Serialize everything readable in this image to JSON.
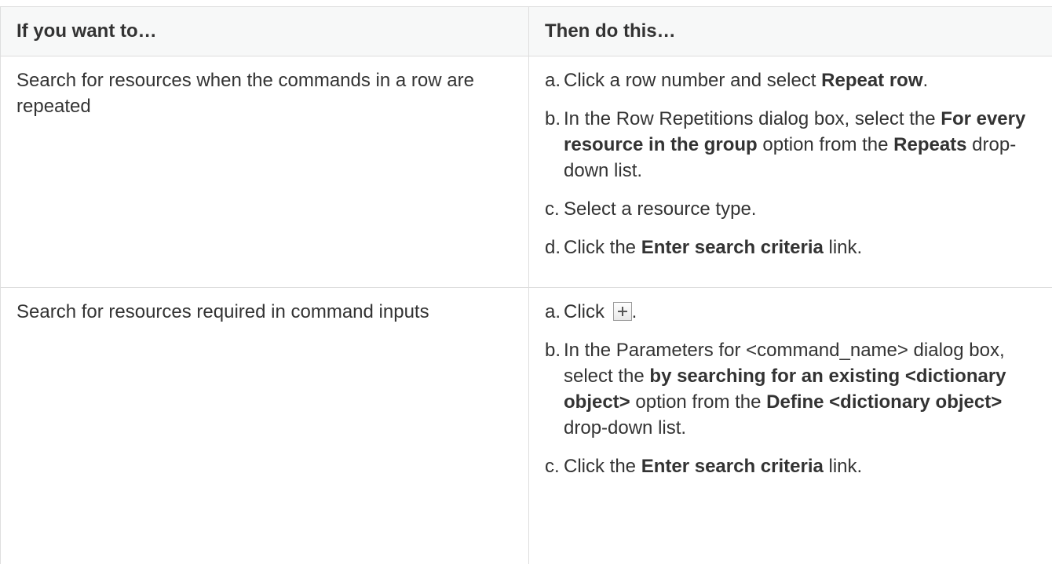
{
  "table": {
    "headers": [
      "If you want to…",
      "Then do this…"
    ],
    "rows": [
      {
        "condition": "Search for resources when the commands in a row are repeated",
        "steps": [
          {
            "mark": "a.",
            "parts": [
              {
                "t": "Click a row number and select "
              },
              {
                "t": "Repeat row",
                "b": true
              },
              {
                "t": "."
              }
            ]
          },
          {
            "mark": "b.",
            "parts": [
              {
                "t": "In the Row Repetitions dialog box, select the "
              },
              {
                "t": "For every resource in the group",
                "b": true
              },
              {
                "t": " option from the "
              },
              {
                "t": "Repeats",
                "b": true
              },
              {
                "t": " drop-down list."
              }
            ]
          },
          {
            "mark": "c.",
            "parts": [
              {
                "t": "Select a resource type."
              }
            ]
          },
          {
            "mark": "d.",
            "parts": [
              {
                "t": "Click the "
              },
              {
                "t": "Enter search criteria",
                "b": true
              },
              {
                "t": " link."
              }
            ]
          }
        ]
      },
      {
        "condition": "Search for resources required in command inputs",
        "steps": [
          {
            "mark": "a.",
            "parts": [
              {
                "t": "Click "
              },
              {
                "icon": "plus-icon"
              },
              {
                "t": "."
              }
            ]
          },
          {
            "mark": "b.",
            "parts": [
              {
                "t": "In the Parameters for <command_name> dialog box, select the "
              },
              {
                "t": "by searching for an existing <dictionary object>",
                "b": true
              },
              {
                "t": " option from the "
              },
              {
                "t": "Define <dictionary object>",
                "b": true
              },
              {
                "t": " drop-down list."
              }
            ]
          },
          {
            "mark": "c.",
            "parts": [
              {
                "t": "Click the "
              },
              {
                "t": "Enter search criteria",
                "b": true
              },
              {
                "t": " link."
              }
            ]
          }
        ]
      }
    ]
  }
}
